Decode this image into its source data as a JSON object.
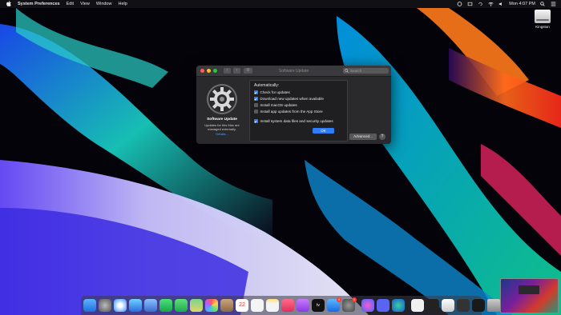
{
  "menubar": {
    "app_name": "System Preferences",
    "menus": [
      "Edit",
      "View",
      "Window",
      "Help"
    ],
    "clock": "Mon 4:07 PM"
  },
  "desktop": {
    "drive_label": "Kingston"
  },
  "window": {
    "title": "Software Update",
    "search_placeholder": "Search",
    "pane_title": "Software Update",
    "pane_description": "Updates for this Mac are managed externally.",
    "pane_link": "Details...",
    "automatically_label": "Automatically:",
    "options": [
      {
        "label": "Check for updates",
        "checked": true
      },
      {
        "label": "Download new updates when available",
        "checked": true
      },
      {
        "label": "Install macOS updates",
        "checked": false
      },
      {
        "label": "Install app updates from the App Store",
        "checked": false
      },
      {
        "label": "Install system data files and security updates",
        "checked": true
      }
    ],
    "ok_label": "OK",
    "advanced_label": "Advanced...",
    "help_label": "?"
  },
  "dock": {
    "badges": {
      "app_store": "4",
      "system_preferences": "1"
    }
  },
  "colors": {
    "accent": "#2e7cf6",
    "window_bg": "#2a2a2c"
  }
}
